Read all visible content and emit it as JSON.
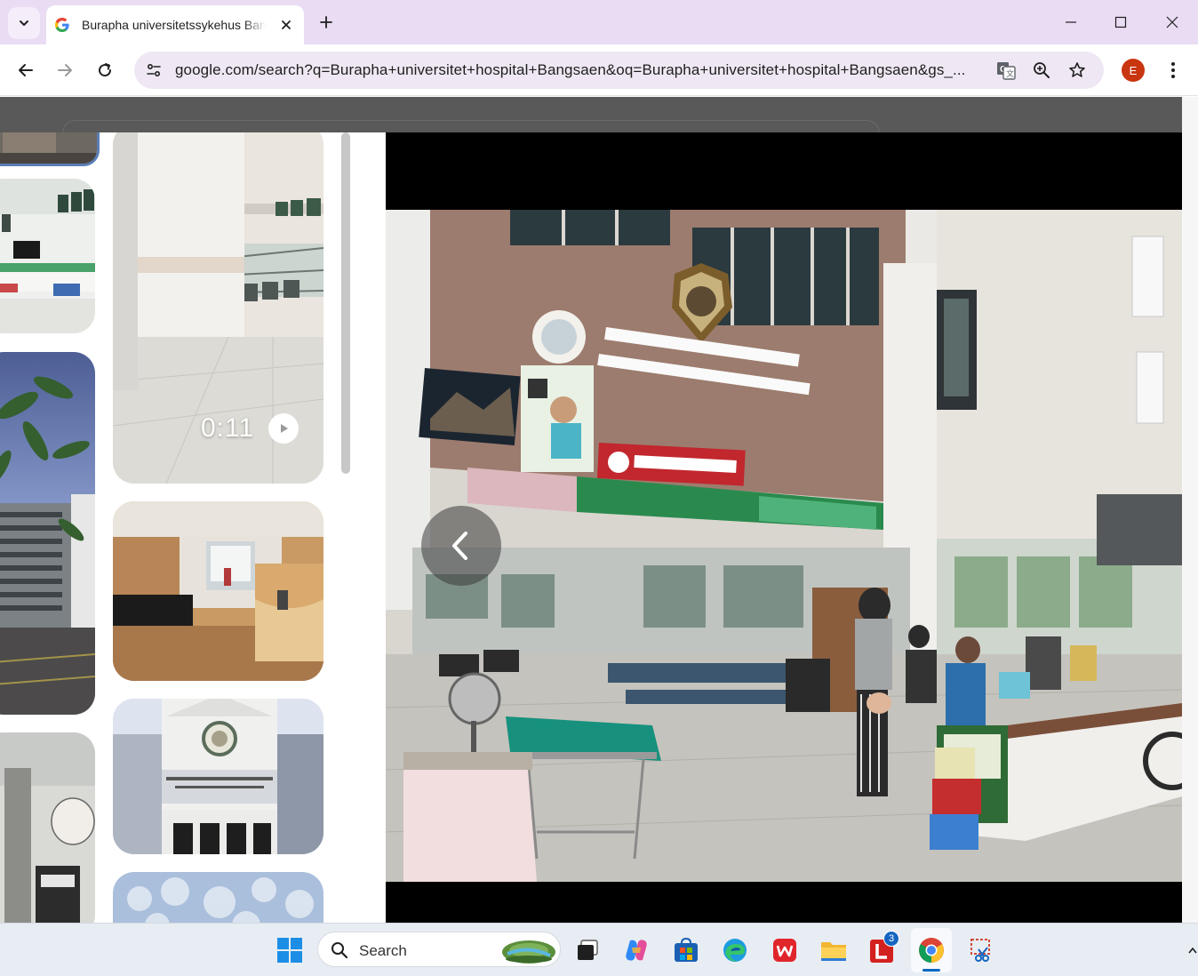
{
  "browser": {
    "tab": {
      "title": "Burapha universitetssykehus Bangsaen - Google Search",
      "favicon": "google-g-icon",
      "close_icon": "close-icon"
    },
    "new_tab_icon": "plus-icon",
    "window_controls": [
      "minimize-icon",
      "maximize-icon",
      "close-icon"
    ],
    "nav": [
      "back-arrow-icon",
      "forward-arrow-icon",
      "reload-icon"
    ],
    "url": "google.com/search?q=Burapha+universitet+hospital+Bangsaen&oq=Burapha+universitet+hospital+Bangsaen&gs_...",
    "omnibox_icons": [
      "site-info-icon",
      "translate-icon",
      "zoom-icon",
      "bookmark-star-icon"
    ],
    "profile_initial": "E",
    "profile_color": "#c8350f"
  },
  "images_panel": {
    "video_duration": "0:11",
    "video_icon": "play-icon",
    "thumbnails": [
      "hospital-corridor",
      "hospital-waiting-room",
      "palm-tree-building",
      "patient-room",
      "hospital-building-facade",
      "sky-texture",
      "signboard"
    ]
  },
  "viewer": {
    "prev_icon": "chevron-left-icon",
    "photo_subject": "hospital-lobby-photo"
  },
  "taskbar": {
    "search_label": "Search",
    "apps": [
      "windows-start-icon",
      "task-view-icon",
      "copilot-icon",
      "store-icon",
      "edge-icon",
      "wps-icon",
      "file-explorer-icon",
      "l-app-icon",
      "chrome-icon",
      "snipping-tool-icon"
    ],
    "l_app_badge": "3",
    "accent": "#0067c0"
  }
}
